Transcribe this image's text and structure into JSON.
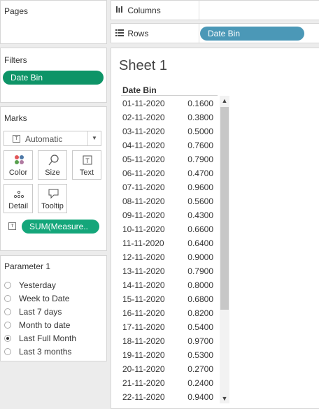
{
  "pages": {
    "title": "Pages"
  },
  "filters": {
    "title": "Filters",
    "items": [
      "Date Bin"
    ]
  },
  "marks": {
    "title": "Marks",
    "mark_type": "Automatic",
    "mark_type_icon": "text-mark-icon",
    "buttons": [
      {
        "label": "Color",
        "icon": "color-icon"
      },
      {
        "label": "Size",
        "icon": "size-icon"
      },
      {
        "label": "Text",
        "icon": "text-icon"
      },
      {
        "label": "Detail",
        "icon": "detail-icon"
      },
      {
        "label": "Tooltip",
        "icon": "tooltip-icon"
      }
    ],
    "field": {
      "label": "SUM(Measure..",
      "icon": "text-mark-icon"
    }
  },
  "parameter": {
    "title": "Parameter 1",
    "options": [
      {
        "label": "Yesterday",
        "selected": false
      },
      {
        "label": "Week to Date",
        "selected": false
      },
      {
        "label": "Last 7 days",
        "selected": false
      },
      {
        "label": "Month to date",
        "selected": false
      },
      {
        "label": "Last Full Month",
        "selected": true
      },
      {
        "label": "Last 3 months",
        "selected": false
      }
    ]
  },
  "shelves": {
    "columns": {
      "label": "Columns",
      "icon": "columns-icon"
    },
    "rows": {
      "label": "Rows",
      "icon": "rows-icon",
      "pill": "Date Bin"
    }
  },
  "sheet": {
    "title": "Sheet 1",
    "column_header": "Date Bin",
    "rows": [
      {
        "date": "01-11-2020",
        "value": "0.1600"
      },
      {
        "date": "02-11-2020",
        "value": "0.3800"
      },
      {
        "date": "03-11-2020",
        "value": "0.5000"
      },
      {
        "date": "04-11-2020",
        "value": "0.7600"
      },
      {
        "date": "05-11-2020",
        "value": "0.7900"
      },
      {
        "date": "06-11-2020",
        "value": "0.4700"
      },
      {
        "date": "07-11-2020",
        "value": "0.9600"
      },
      {
        "date": "08-11-2020",
        "value": "0.5600"
      },
      {
        "date": "09-11-2020",
        "value": "0.4300"
      },
      {
        "date": "10-11-2020",
        "value": "0.6600"
      },
      {
        "date": "11-11-2020",
        "value": "0.6400"
      },
      {
        "date": "12-11-2020",
        "value": "0.9000"
      },
      {
        "date": "13-11-2020",
        "value": "0.7900"
      },
      {
        "date": "14-11-2020",
        "value": "0.8000"
      },
      {
        "date": "15-11-2020",
        "value": "0.6800"
      },
      {
        "date": "16-11-2020",
        "value": "0.8200"
      },
      {
        "date": "17-11-2020",
        "value": "0.5400"
      },
      {
        "date": "18-11-2020",
        "value": "0.9700"
      },
      {
        "date": "19-11-2020",
        "value": "0.5300"
      },
      {
        "date": "20-11-2020",
        "value": "0.2700"
      },
      {
        "date": "21-11-2020",
        "value": "0.2400"
      },
      {
        "date": "22-11-2020",
        "value": "0.9400"
      }
    ]
  },
  "colors": {
    "filter_pill": "#0e9467",
    "measure_pill": "#14a67a",
    "dimension_pill": "#4b98b7"
  }
}
